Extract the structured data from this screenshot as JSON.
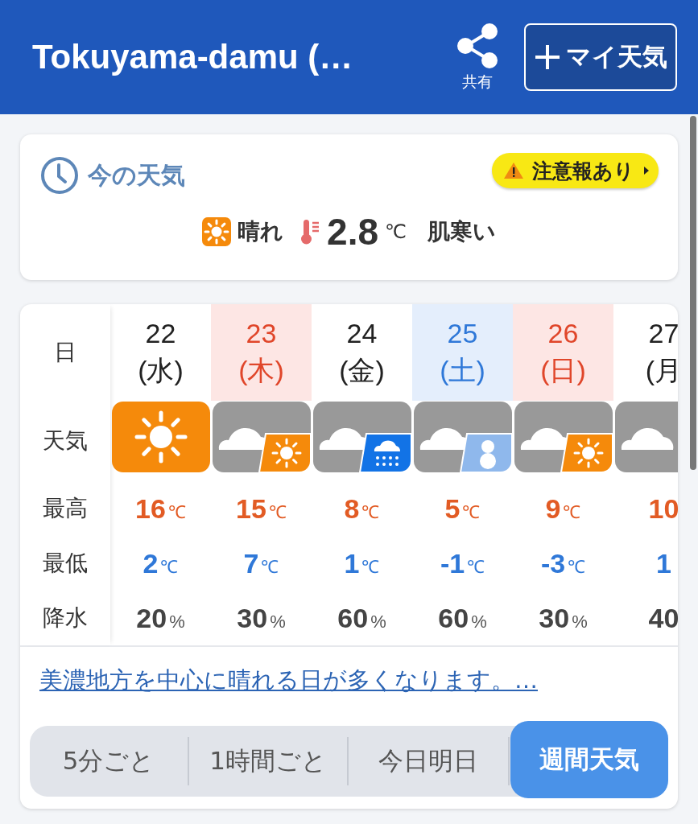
{
  "header": {
    "title": "Tokuyama-damu (…",
    "share_label": "共有",
    "my_weather_button": "マイ天気"
  },
  "current": {
    "title": "今の天気",
    "warning": "注意報あり",
    "weather": {
      "kind": "sunny"
    },
    "condition": "晴れ",
    "temperature": "2.8",
    "unit": "℃",
    "feeling": "肌寒い"
  },
  "forecast": {
    "labels": {
      "date": "日",
      "weather": "天気",
      "high": "最高",
      "low": "最低",
      "precip": "降水"
    },
    "days": [
      {
        "date": "22",
        "weekday": "(水)",
        "kind": "weekday",
        "weather": {
          "kind": "sunny"
        },
        "high": {
          "value": "16",
          "unit": "℃"
        },
        "low": {
          "value": "2",
          "unit": "℃"
        },
        "precip": {
          "value": "20",
          "unit": "%"
        }
      },
      {
        "date": "23",
        "weekday": "(木)",
        "kind": "holiday",
        "weather": {
          "kind": "cloudy_sunny"
        },
        "high": {
          "value": "15",
          "unit": "℃"
        },
        "low": {
          "value": "7",
          "unit": "℃"
        },
        "precip": {
          "value": "30",
          "unit": "%"
        }
      },
      {
        "date": "24",
        "weekday": "(金)",
        "kind": "weekday",
        "weather": {
          "kind": "cloudy_rain"
        },
        "high": {
          "value": "8",
          "unit": "℃"
        },
        "low": {
          "value": "1",
          "unit": "℃"
        },
        "precip": {
          "value": "60",
          "unit": "%"
        }
      },
      {
        "date": "25",
        "weekday": "(土)",
        "kind": "saturday",
        "weather": {
          "kind": "cloudy_snow"
        },
        "high": {
          "value": "5",
          "unit": "℃"
        },
        "low": {
          "value": "-1",
          "unit": "℃"
        },
        "precip": {
          "value": "60",
          "unit": "%"
        }
      },
      {
        "date": "26",
        "weekday": "(日)",
        "kind": "holiday",
        "weather": {
          "kind": "cloudy_sunny"
        },
        "high": {
          "value": "9",
          "unit": "℃"
        },
        "low": {
          "value": "-3",
          "unit": "℃"
        },
        "precip": {
          "value": "30",
          "unit": "%"
        }
      },
      {
        "date": "27",
        "weekday": "(月",
        "kind": "weekday",
        "weather": {
          "kind": "cloudy"
        },
        "high": {
          "value": "10"
        },
        "low": {
          "value": "1"
        },
        "precip": {
          "value": "40"
        }
      }
    ]
  },
  "summary_link": "美濃地方を中心に晴れる日が多くなります。…",
  "tabs": [
    {
      "label": "5分ごと",
      "selected": false
    },
    {
      "label": "1時間ごと",
      "selected": false
    },
    {
      "label": "今日明日",
      "selected": false
    },
    {
      "label": "週間天気",
      "selected": true
    }
  ]
}
